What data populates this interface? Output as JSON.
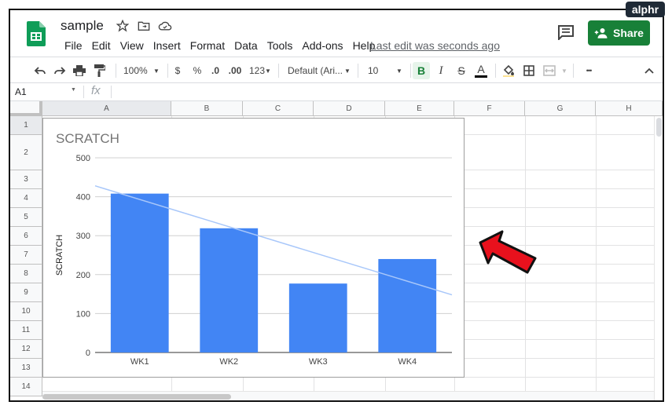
{
  "badge": "alphr",
  "doc": {
    "title": "sample",
    "last_edit": "Last edit was seconds ago",
    "share_label": "Share"
  },
  "menu": [
    "File",
    "Edit",
    "View",
    "Insert",
    "Format",
    "Data",
    "Tools",
    "Add-ons",
    "Help"
  ],
  "toolbar": {
    "zoom": "100%",
    "currency": "$",
    "percent": "%",
    "dec_less": ".0",
    "dec_more": ".00",
    "format_more": "123",
    "font": "Default (Ari...",
    "font_size": "10",
    "bold": "B",
    "italic": "I",
    "strike": "S",
    "text_color": "A",
    "more": "•••"
  },
  "formula_bar": {
    "name_box": "A1",
    "fx": "fx"
  },
  "columns": [
    "A",
    "B",
    "C",
    "D",
    "E",
    "F",
    "G",
    "H"
  ],
  "rows": [
    "1",
    "2",
    "3",
    "4",
    "5",
    "6",
    "7",
    "8",
    "9",
    "10",
    "11",
    "12",
    "13",
    "14"
  ],
  "colors": {
    "share_green": "#188038",
    "bar_blue": "#4285f4",
    "trend": "#a8c7fa",
    "arrow_red": "#e8111d"
  },
  "chart_data": {
    "type": "bar",
    "title": "SCRATCH",
    "ylabel": "SCRATCH",
    "xlabel": "",
    "categories": [
      "WK1",
      "WK2",
      "WK3",
      "WK4"
    ],
    "values": [
      408,
      319,
      177,
      240
    ],
    "ylim": [
      0,
      500
    ],
    "yticks": [
      "0",
      "100",
      "200",
      "300",
      "400",
      "500"
    ],
    "trendline": {
      "start": 428,
      "end": 148
    },
    "grid": true
  }
}
